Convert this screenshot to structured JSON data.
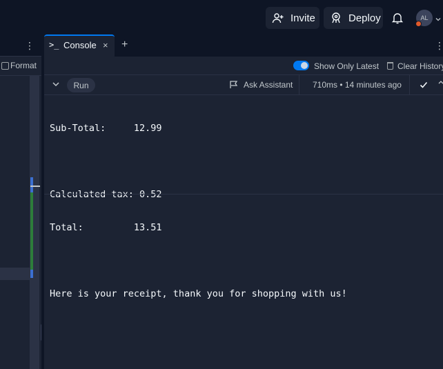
{
  "topbar": {
    "invite_label": "Invite",
    "deploy_label": "Deploy",
    "avatar_initials": "AL"
  },
  "editor": {
    "format_label": "Format"
  },
  "console": {
    "tab_icon": ">_",
    "tab_label": "Console",
    "tab_close": "×",
    "add_tab": "+",
    "show_only_latest_label": "Show Only Latest",
    "show_only_latest_on": true,
    "clear_history_label": "Clear History",
    "entry": {
      "run_label": "Run",
      "ask_assistant_label": "Ask Assistant",
      "timing": "710ms • 14 minutes ago"
    },
    "output_lines": [
      "Sub-Total:     12.99",
      "",
      "Calculated tax: 0.52",
      "Total:         13.51",
      "",
      "Here is your receipt, thank you for shopping with us!"
    ]
  },
  "colors": {
    "accent": "#0079f2",
    "background": "#1c2333",
    "topbar": "#0e1525",
    "notification_dot": "#e0592a"
  }
}
